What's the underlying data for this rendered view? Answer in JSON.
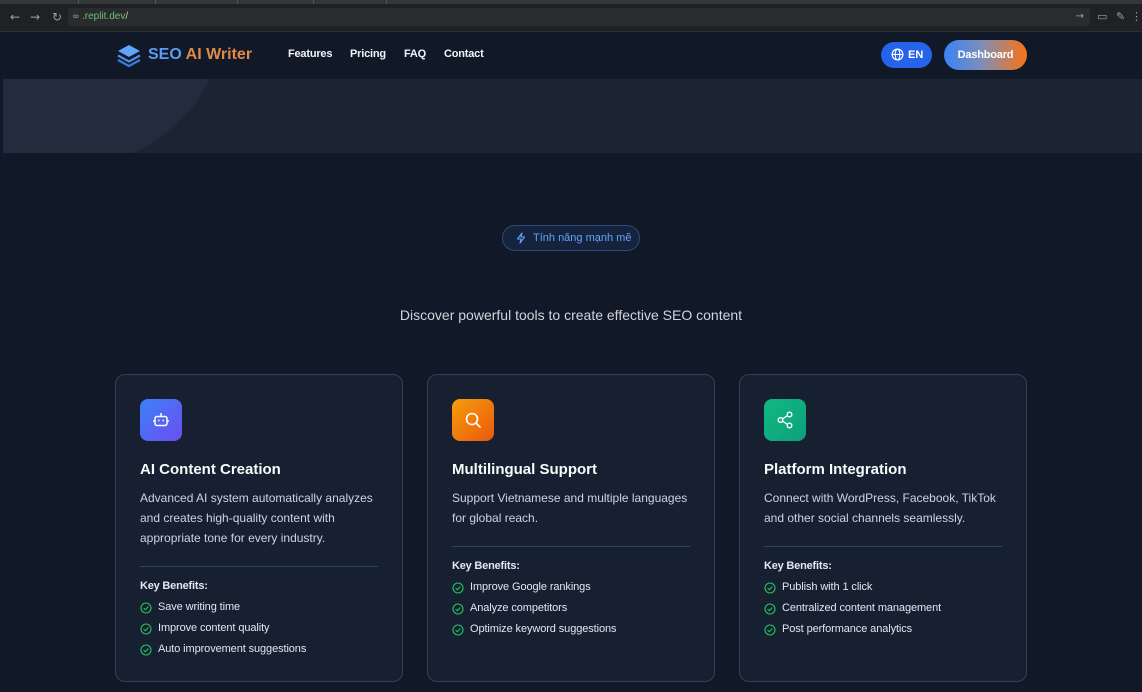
{
  "browser": {
    "url_host": ".replit.dev",
    "url_path": "/"
  },
  "header": {
    "logo_seo": "SEO",
    "logo_rest": "AI Writer",
    "nav": [
      "Features",
      "Pricing",
      "FAQ",
      "Contact"
    ],
    "lang_label": "EN",
    "dashboard_label": "Dashboard"
  },
  "features": {
    "badge": "Tính năng mạnh mẽ",
    "subtitle": "Discover powerful tools to create effective SEO content",
    "key_benefits_label": "Key Benefits:",
    "cards": [
      {
        "icon": "robot-icon",
        "color": "#5b5ef0",
        "title": "AI Content Creation",
        "desc_lines": [
          "Advanced AI system automatically analyzes",
          "and creates high-quality content with",
          "appropriate tone for every industry."
        ],
        "benefits": [
          "Save writing time",
          "Improve content quality",
          "Auto improvement suggestions"
        ]
      },
      {
        "icon": "search-icon",
        "color": "#f97316",
        "title": "Multilingual Support",
        "desc_lines": [
          "Support Vietnamese and multiple languages",
          "for global reach."
        ],
        "benefits": [
          "Improve Google rankings",
          "Analyze competitors",
          "Optimize keyword suggestions"
        ]
      },
      {
        "icon": "share-icon",
        "color": "#10b981",
        "title": "Platform Integration",
        "desc_lines": [
          "Connect with WordPress, Facebook, TikTok",
          "and other social channels seamlessly."
        ],
        "benefits": [
          "Publish with 1 click",
          "Centralized content management",
          "Post performance analytics"
        ]
      }
    ]
  },
  "colors": {
    "accent_blue": "#2563eb",
    "check_green": "#22c55e",
    "background": "#111827"
  }
}
